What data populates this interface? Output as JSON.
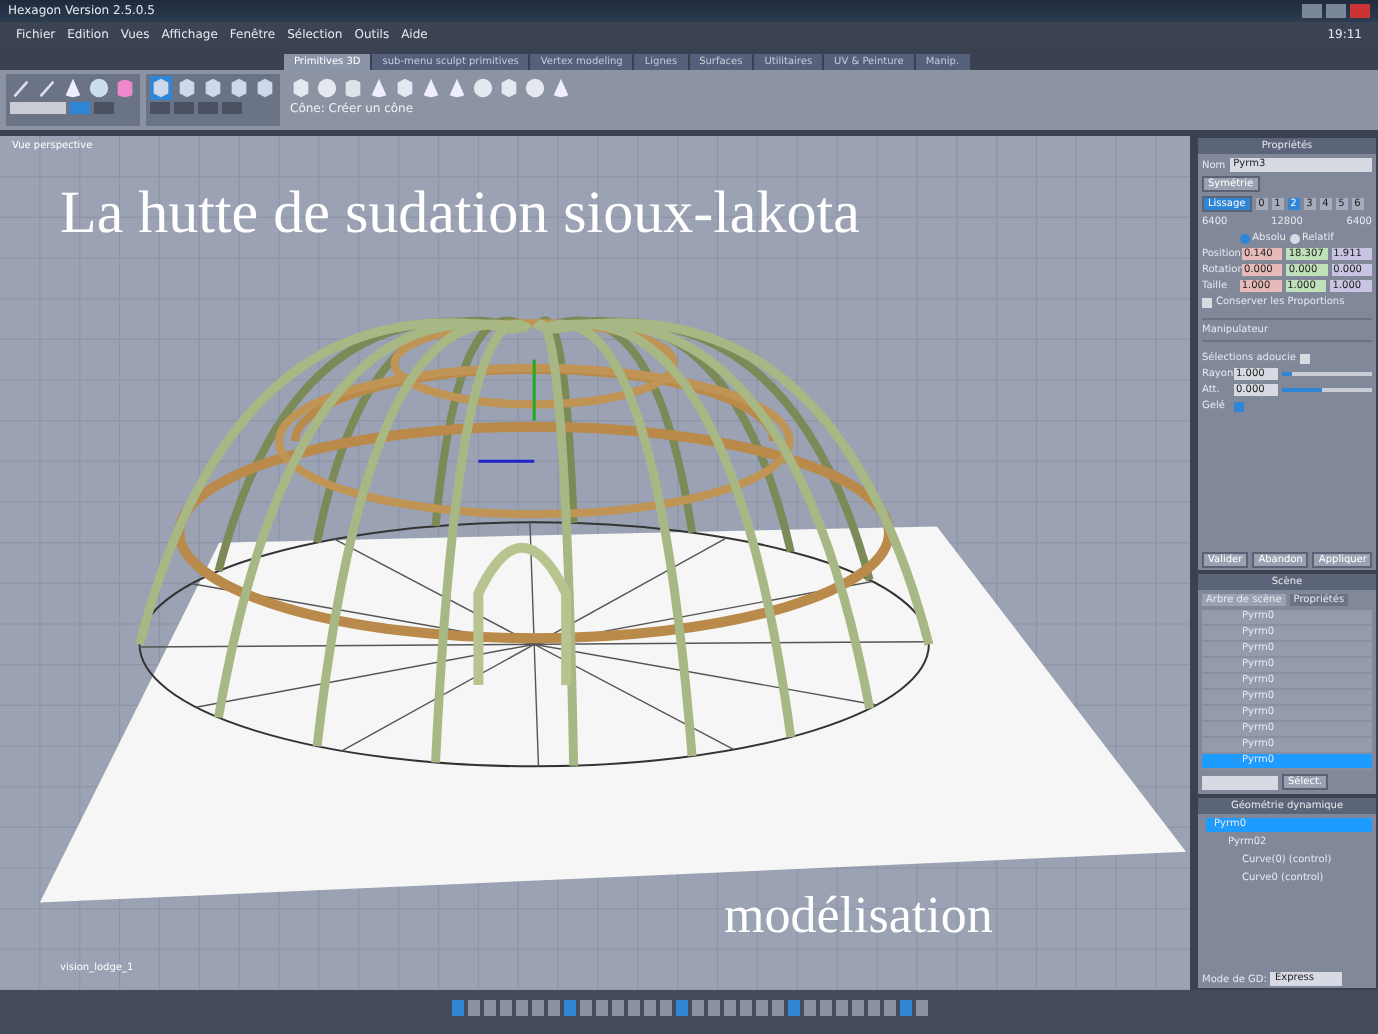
{
  "window": {
    "title": "Hexagon Version 2.5.0.5",
    "clock": "19:11"
  },
  "menu": [
    "Fichier",
    "Edition",
    "Vues",
    "Affichage",
    "Fenêtre",
    "Sélection",
    "Outils",
    "Aide"
  ],
  "tabs": [
    {
      "label": "Primitives 3D",
      "selected": true
    },
    {
      "label": "sub-menu sculpt primitives",
      "selected": false
    },
    {
      "label": "Vertex modeling",
      "selected": false
    },
    {
      "label": "Lignes",
      "selected": false
    },
    {
      "label": "Surfaces",
      "selected": false
    },
    {
      "label": "Utilitaires",
      "selected": false
    },
    {
      "label": "UV & Peinture",
      "selected": false
    },
    {
      "label": "Manip.",
      "selected": false
    }
  ],
  "toolbar": {
    "hint": "Cône: Créer un cône"
  },
  "viewport": {
    "label": "Vue perspective",
    "overlay_title": "La hutte de sudation sioux-lakota",
    "overlay_caption": "modélisation",
    "object_label": "vision_lodge_1"
  },
  "properties": {
    "title": "Propriétés",
    "name_label": "Nom",
    "name": "Pyrm3",
    "symmetry": "Symétrie",
    "smoothing": "Lissage",
    "levels": [
      {
        "label": "0",
        "selected": false
      },
      {
        "label": "1",
        "selected": false
      },
      {
        "label": "2",
        "selected": true
      },
      {
        "label": "3",
        "selected": false
      },
      {
        "label": "4",
        "selected": false
      },
      {
        "label": "5",
        "selected": false
      },
      {
        "label": "6",
        "selected": false
      }
    ],
    "counts": [
      "6400",
      "12800",
      "6400"
    ],
    "modes": [
      {
        "label": "Absolu",
        "selected": true
      },
      {
        "label": "Relatif",
        "selected": false
      }
    ],
    "transforms": [
      {
        "label": "Position",
        "values": [
          "0.140",
          "18.307",
          "1.911"
        ]
      },
      {
        "label": "Rotation",
        "values": [
          "0.000",
          "0.000",
          "0.000"
        ]
      },
      {
        "label": "Taille",
        "values": [
          "1.000",
          "1.000",
          "1.000"
        ]
      }
    ],
    "keep_proportions": {
      "label": "Conserver les Proportions",
      "checked": false
    },
    "manipulator": "Manipulateur",
    "soft_selection": {
      "label": "Sélections adoucie",
      "checked": false
    },
    "sliders": [
      {
        "label": "Rayon",
        "value": "1.000",
        "level": 0.1
      },
      {
        "label": "Att.",
        "value": "0.000",
        "level": 0.45
      }
    ],
    "frozen": {
      "label": "Gelé",
      "checked": true
    },
    "buttons": [
      "Valider",
      "Abandon",
      "Appliquer"
    ]
  },
  "scene": {
    "title": "Scène",
    "tabs": [
      {
        "label": "Arbre de scène",
        "selected": true
      },
      {
        "label": "Propriétés",
        "selected": false
      }
    ],
    "items": [
      {
        "label": "Pyrm0",
        "selected": false
      },
      {
        "label": "Pyrm0",
        "selected": false
      },
      {
        "label": "Pyrm0",
        "selected": false
      },
      {
        "label": "Pyrm0",
        "selected": false
      },
      {
        "label": "Pyrm0",
        "selected": false
      },
      {
        "label": "Pyrm0",
        "selected": false
      },
      {
        "label": "Pyrm0",
        "selected": false
      },
      {
        "label": "Pyrm0",
        "selected": false
      },
      {
        "label": "Pyrm0",
        "selected": false
      },
      {
        "label": "Pyrm0",
        "selected": true
      }
    ],
    "select_button": "Sélect."
  },
  "dynamic_geometry": {
    "title": "Géométrie dynamique",
    "tree": [
      {
        "label": "Pyrm0",
        "selected": true,
        "children": [
          {
            "label": "Pyrm02",
            "selected": false,
            "children": [
              {
                "label": "Curve(0) (control)",
                "selected": false
              },
              {
                "label": "Curve0 (control)",
                "selected": false
              }
            ]
          }
        ]
      }
    ],
    "mode_label": "Mode de GD:",
    "mode_value": "Express"
  }
}
